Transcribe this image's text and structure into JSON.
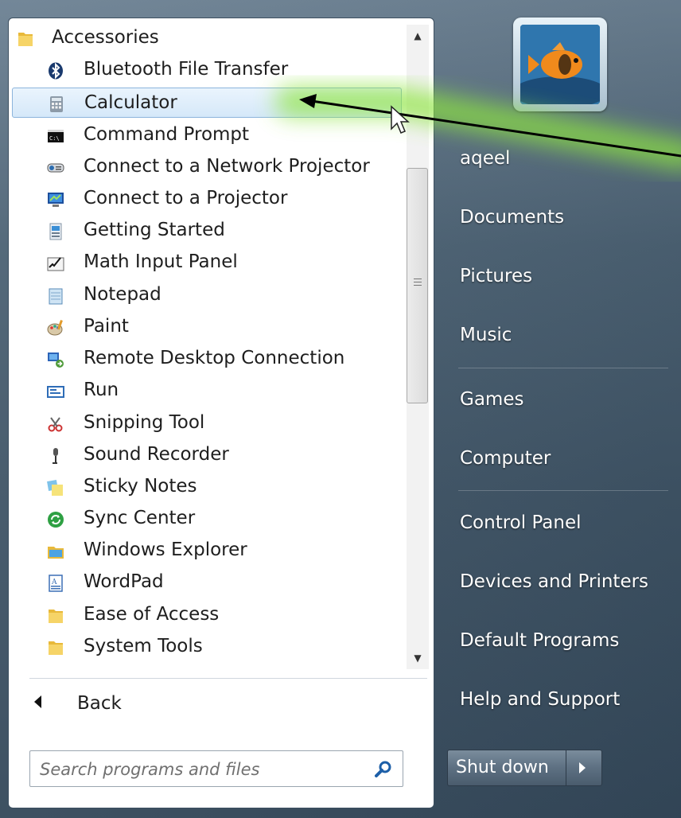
{
  "programs": {
    "folder_label": "Accessories",
    "items": [
      {
        "label": "Bluetooth File Transfer",
        "icon": "bluetooth-icon"
      },
      {
        "label": "Calculator",
        "icon": "calculator-icon",
        "selected": true
      },
      {
        "label": "Command Prompt",
        "icon": "command-prompt-icon"
      },
      {
        "label": "Connect to a Network Projector",
        "icon": "network-projector-icon"
      },
      {
        "label": "Connect to a Projector",
        "icon": "projector-icon"
      },
      {
        "label": "Getting Started",
        "icon": "getting-started-icon"
      },
      {
        "label": "Math Input Panel",
        "icon": "math-input-icon"
      },
      {
        "label": "Notepad",
        "icon": "notepad-icon"
      },
      {
        "label": "Paint",
        "icon": "paint-icon"
      },
      {
        "label": "Remote Desktop Connection",
        "icon": "remote-desktop-icon"
      },
      {
        "label": "Run",
        "icon": "run-icon"
      },
      {
        "label": "Snipping Tool",
        "icon": "snipping-tool-icon"
      },
      {
        "label": "Sound Recorder",
        "icon": "microphone-icon"
      },
      {
        "label": "Sticky Notes",
        "icon": "sticky-notes-icon"
      },
      {
        "label": "Sync Center",
        "icon": "sync-icon"
      },
      {
        "label": "Windows Explorer",
        "icon": "explorer-folder-icon"
      },
      {
        "label": "WordPad",
        "icon": "wordpad-icon"
      },
      {
        "label": "Ease of Access",
        "icon": "folder-icon"
      },
      {
        "label": "System Tools",
        "icon": "folder-icon"
      }
    ]
  },
  "back": {
    "label": "Back"
  },
  "search": {
    "placeholder": "Search programs and files"
  },
  "right_pane": {
    "user": "aqeel",
    "links": [
      "Documents",
      "Pictures",
      "Music",
      "Games",
      "Computer",
      "Control Panel",
      "Devices and Printers",
      "Default Programs",
      "Help and Support"
    ]
  },
  "shutdown": {
    "label": "Shut down"
  },
  "colors": {
    "selection": "#d5e8f9",
    "highlight_arrow_glow": "#7ed321",
    "pane_bg": "#4c6274"
  }
}
